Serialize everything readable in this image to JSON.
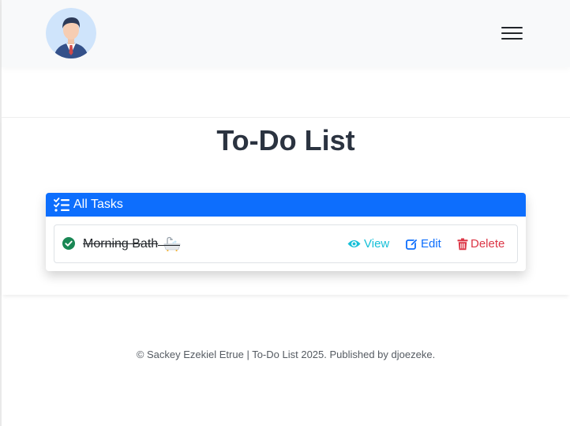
{
  "navbar": {
    "avatar_icon": "user-avatar-icon",
    "menu_icon": "hamburger-menu-icon"
  },
  "page": {
    "title": "To-Do List"
  },
  "card": {
    "header_icon": "list-check-icon",
    "header_title": "All Tasks",
    "header_color": "#0d6efd"
  },
  "tasks": [
    {
      "label": "Morning Bath",
      "emoji": "bathtub-icon",
      "completed": true,
      "status_icon": "check-circle-icon",
      "actions": {
        "view": "View",
        "edit": "Edit",
        "delete": "Delete"
      }
    }
  ],
  "colors": {
    "view": "#17c0d8",
    "edit": "#0d6efd",
    "delete": "#dc3545",
    "done": "#198754"
  },
  "footer": {
    "text": "© Sackey Ezekiel Etrue | To-Do List 2025. Published by djoezeke."
  }
}
